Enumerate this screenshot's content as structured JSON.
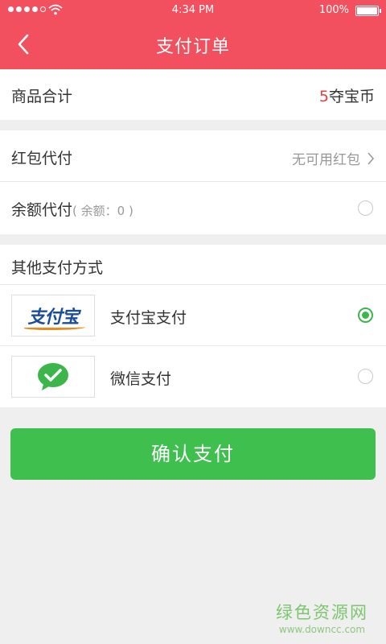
{
  "status_bar": {
    "time": "4:34 PM",
    "battery": "100%",
    "signal_dots": 5,
    "signal_filled": 4
  },
  "header": {
    "title": "支付订单",
    "color": "#f2505e"
  },
  "summary": {
    "label": "商品合计",
    "amount": "5",
    "unit": "夺宝币"
  },
  "hongbao": {
    "label": "红包代付",
    "value": "无可用红包"
  },
  "balance": {
    "label": "余额代付",
    "sub": "( 余额：0 )"
  },
  "other_methods": {
    "heading": "其他支付方式",
    "alipay": {
      "logo_text": "支付宝",
      "label": "支付宝支付",
      "selected": true
    },
    "wechat": {
      "label": "微信支付",
      "selected": false
    }
  },
  "confirm_button": {
    "label": "确认支付",
    "color": "#3ebf4e"
  },
  "watermark": {
    "main": "绿色资源网",
    "sub": "www.downcc.com"
  }
}
